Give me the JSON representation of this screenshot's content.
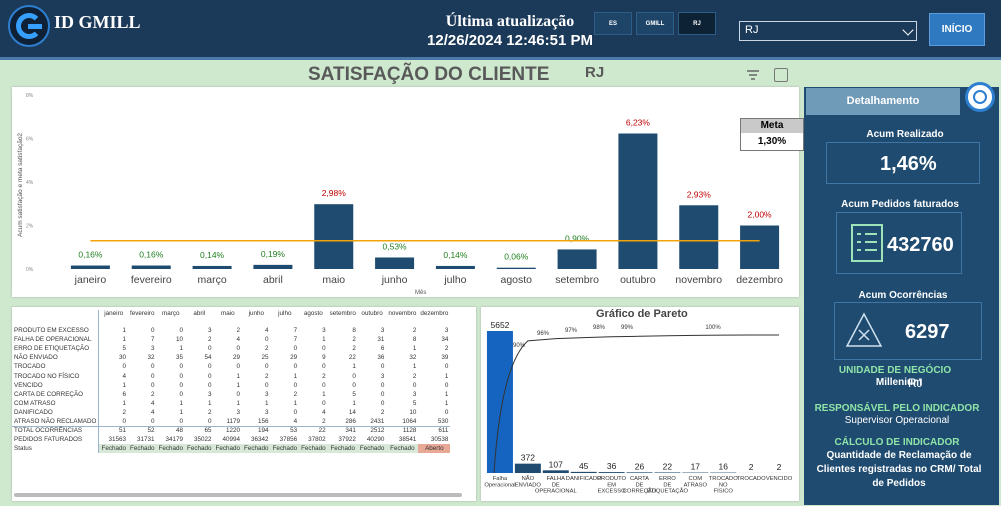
{
  "header": {
    "brand": "ID GMILL",
    "update_label": "Última atualização",
    "update_time": "12/26/2024 12:46:51 PM",
    "tabs": [
      "ES",
      "GMILL",
      "RJ"
    ],
    "selected_region": "RJ",
    "home_button": "INÍCIO"
  },
  "title": {
    "main": "SATISFAÇÃO DO CLIENTE",
    "region": "RJ"
  },
  "chart_data": [
    {
      "type": "bar",
      "ylabel": "Acum satisfação e meta satisfação2",
      "xlabel": "Mês",
      "ylim": [
        0,
        8
      ],
      "yticks": [
        "0%",
        "2%",
        "4%",
        "6%",
        "8%"
      ],
      "categories": [
        "janeiro",
        "fevereiro",
        "março",
        "abril",
        "maio",
        "junho",
        "julho",
        "agosto",
        "setembro",
        "outubro",
        "novembro",
        "dezembro"
      ],
      "values": [
        0.16,
        0.16,
        0.14,
        0.19,
        2.98,
        0.53,
        0.14,
        0.06,
        0.9,
        6.23,
        2.93,
        2.0
      ],
      "labels": [
        "0,16%",
        "0,16%",
        "0,14%",
        "0,19%",
        "2,98%",
        "0,53%",
        "0,14%",
        "0,06%",
        "0,90%",
        "6,23%",
        "2,93%",
        "2,00%"
      ],
      "meta_line": 1.3,
      "colors": {
        "bar": "#1f4b70",
        "meta": "#f0a30a",
        "above": "#c00000",
        "below": "#1e7f1e"
      }
    },
    {
      "type": "bar",
      "title": "Gráfico de Pareto",
      "categories": [
        "Falha Operacional",
        "NÃO ENVIADO",
        "FALHA DE OPERACIONAL",
        "DANIFICADO",
        "PRODUTO EM EXCESSO",
        "CARTA DE CORREÇÃO",
        "ERRO DE ETIQUETAÇÃO",
        "COM ATRASO",
        "TROCADO NO FÍSICO",
        "TROCADO",
        "VENCIDO"
      ],
      "values": [
        5652,
        372,
        107,
        45,
        36,
        26,
        22,
        17,
        16,
        2,
        2
      ],
      "cumulative_labels": [
        "90%",
        "96%",
        "97%",
        "98%",
        "99%",
        "100%"
      ],
      "colors": {
        "bar": "#1565c0",
        "line": "#333333"
      }
    }
  ],
  "meta_box": {
    "label": "Meta",
    "value": "1,30%"
  },
  "table": {
    "months": [
      "janeiro",
      "fevereiro",
      "março",
      "abril",
      "maio",
      "junho",
      "julho",
      "agosto",
      "setembro",
      "outubro",
      "novembro",
      "dezembro"
    ],
    "rows": [
      {
        "label": "PRODUTO EM EXCESSO",
        "values": [
          "1",
          "0",
          "0",
          "3",
          "2",
          "4",
          "7",
          "3",
          "8",
          "3",
          "2",
          "3"
        ]
      },
      {
        "label": "FALHA DE OPERACIONAL",
        "values": [
          "1",
          "7",
          "10",
          "2",
          "4",
          "0",
          "7",
          "1",
          "2",
          "31",
          "8",
          "34"
        ]
      },
      {
        "label": "ERRO DE ETIQUETAÇÃO",
        "values": [
          "5",
          "3",
          "1",
          "0",
          "0",
          "2",
          "0",
          "0",
          "2",
          "6",
          "1",
          "2"
        ]
      },
      {
        "label": "NÃO ENVIADO",
        "values": [
          "30",
          "32",
          "35",
          "54",
          "29",
          "25",
          "29",
          "9",
          "22",
          "36",
          "32",
          "39"
        ]
      },
      {
        "label": "TROCADO",
        "values": [
          "0",
          "0",
          "0",
          "0",
          "0",
          "0",
          "0",
          "0",
          "1",
          "0",
          "1",
          "0"
        ]
      },
      {
        "label": "TROCADO NO FÍSICO",
        "values": [
          "4",
          "0",
          "0",
          "0",
          "1",
          "2",
          "1",
          "2",
          "0",
          "3",
          "2",
          "1"
        ]
      },
      {
        "label": "VENCIDO",
        "values": [
          "1",
          "0",
          "0",
          "0",
          "1",
          "0",
          "0",
          "0",
          "0",
          "0",
          "0",
          "0"
        ]
      },
      {
        "label": "CARTA DE CORREÇÃO",
        "values": [
          "6",
          "2",
          "0",
          "3",
          "0",
          "3",
          "2",
          "1",
          "5",
          "0",
          "3",
          "1"
        ]
      },
      {
        "label": "COM ATRASO",
        "values": [
          "1",
          "4",
          "1",
          "1",
          "1",
          "1",
          "1",
          "0",
          "1",
          "0",
          "5",
          "1"
        ]
      },
      {
        "label": "DANIFICADO",
        "values": [
          "2",
          "4",
          "1",
          "2",
          "3",
          "3",
          "0",
          "4",
          "14",
          "2",
          "10",
          "0"
        ]
      },
      {
        "label": "ATRASO NÃO RECLAMADO",
        "values": [
          "0",
          "0",
          "0",
          "0",
          "1179",
          "156",
          "4",
          "2",
          "286",
          "2431",
          "1064",
          "530"
        ]
      }
    ],
    "total_label": "TOTAL OCORRÊNCIAS",
    "totals": [
      "51",
      "52",
      "48",
      "65",
      "1220",
      "194",
      "53",
      "22",
      "341",
      "2512",
      "1128",
      "611"
    ],
    "pedidos_label": "PEDIDOS FATURADOS",
    "pedidos": [
      "31563",
      "31731",
      "34179",
      "35022",
      "40994",
      "36342",
      "37856",
      "37802",
      "37922",
      "40290",
      "38541",
      "30538"
    ],
    "status_label": "Status",
    "status": [
      "Fechado",
      "Fechado",
      "Fechado",
      "Fechado",
      "Fechado",
      "Fechado",
      "Fechado",
      "Fechado",
      "Fechado",
      "Fechado",
      "Fechado",
      "Aberto"
    ]
  },
  "side": {
    "header": "Detalhamento",
    "acum_realizado_label": "Acum Realizado",
    "acum_realizado": "1,46%",
    "pedidos_label": "Acum Pedidos faturados",
    "pedidos": "432760",
    "ocorr_label": "Acum Ocorrências",
    "ocorr": "6297",
    "un_label": "UNIDADE DE NEGÓCIO",
    "un_value": "Millenium",
    "un_region": "RJ",
    "resp_label": "RESPONSÁVEL PELO INDICADOR",
    "resp_value": "Supervisor Operacional",
    "calc_label": "CÁLCULO DE INDICADOR",
    "calc_value": "Quantidade de Reclamação de Clientes registradas no CRM/ Total de Pedidos"
  }
}
